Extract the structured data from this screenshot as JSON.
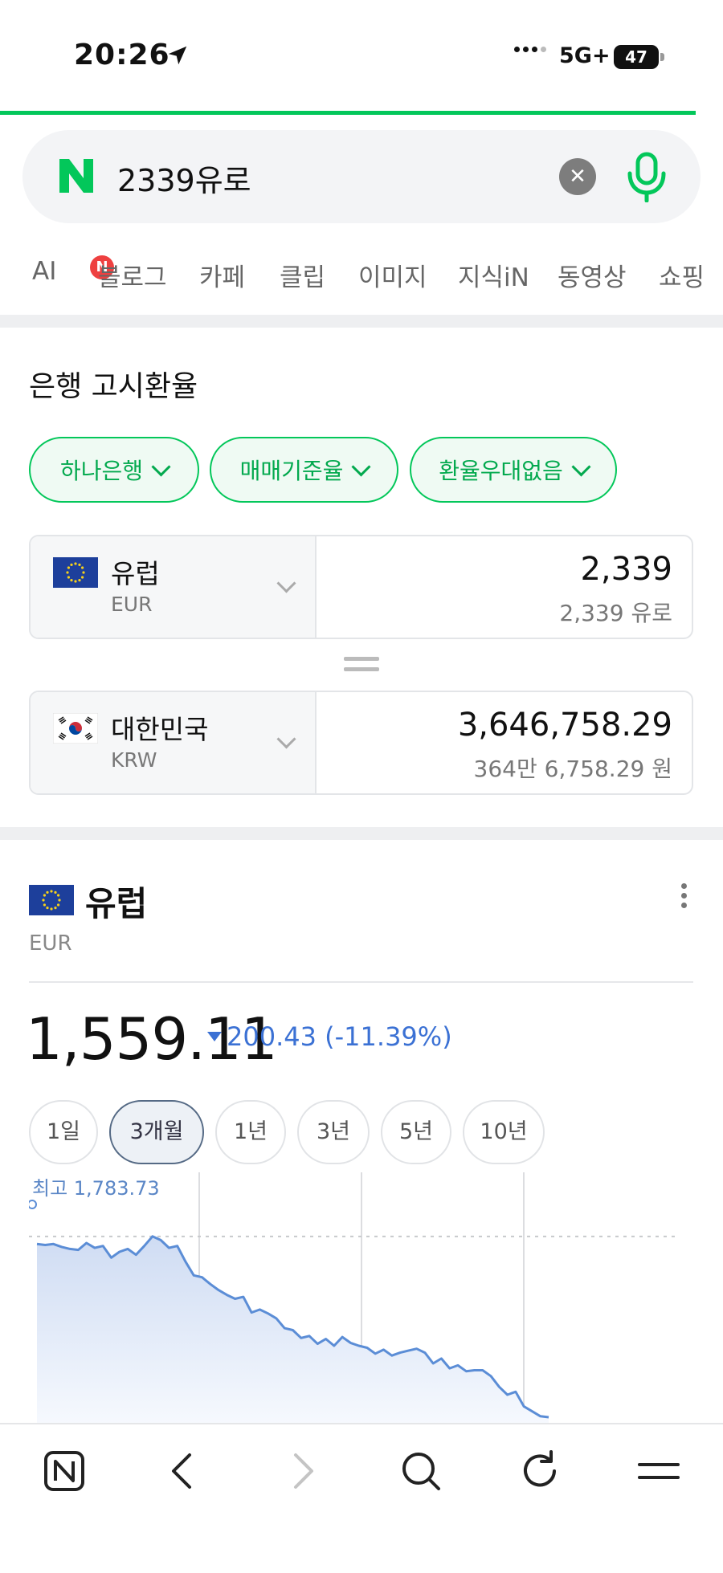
{
  "status_bar": {
    "time": "20:26",
    "network": "5G+",
    "battery": "47"
  },
  "search": {
    "query": "2339유로",
    "logo": "N"
  },
  "tabs": [
    {
      "label": "AI",
      "badge": "N"
    },
    {
      "label": "블로그"
    },
    {
      "label": "카페"
    },
    {
      "label": "클립"
    },
    {
      "label": "이미지"
    },
    {
      "label": "지식iN"
    },
    {
      "label": "동영상"
    },
    {
      "label": "쇼핑"
    }
  ],
  "exchange": {
    "title": "은행 고시환율",
    "chips": [
      "하나은행",
      "매매기준율",
      "환율우대없음"
    ],
    "from": {
      "name": "유럽",
      "code": "EUR",
      "amount": "2,339",
      "amount_read": "2,339 유로"
    },
    "to": {
      "name": "대한민국",
      "code": "KRW",
      "amount": "3,646,758.29",
      "amount_read": "364만 6,758.29 원"
    }
  },
  "rate_section": {
    "name": "유럽",
    "code": "EUR",
    "rate": "1,559.11",
    "change": "200.43 (-11.39%)",
    "change_direction": "down",
    "periods": [
      "1일",
      "3개월",
      "1년",
      "3년",
      "5년",
      "10년"
    ],
    "active_period": "3개월",
    "high_label": "최고 1,783.73"
  },
  "chart_data": {
    "type": "area",
    "title": "",
    "series": [
      {
        "values": [
          1776,
          1775,
          1776,
          1773,
          1771,
          1770,
          1777,
          1772,
          1774,
          1762,
          1768,
          1771,
          1765,
          1774,
          1783.73,
          1780,
          1772,
          1774,
          1758,
          1744,
          1742,
          1735,
          1729,
          1724,
          1720,
          1722,
          1706,
          1709,
          1705,
          1700,
          1690,
          1688,
          1680,
          1682,
          1674,
          1679,
          1672,
          1681,
          1675,
          1672,
          1670,
          1664,
          1668,
          1662,
          1665,
          1667,
          1669,
          1665,
          1654,
          1659,
          1649,
          1652,
          1646,
          1647,
          1647,
          1641,
          1630,
          1622,
          1625,
          1610,
          1605,
          1600,
          1599
        ]
      }
    ],
    "high": 1783.73,
    "ylim": [
      1590,
      1800
    ],
    "grid": true
  },
  "colors": {
    "naver_green": "#03c75a",
    "down_blue": "#3b71d4",
    "chart_line": "#5b8dd6"
  },
  "bottom_bar": [
    "naver-home-icon",
    "back-icon",
    "forward-icon",
    "search-icon",
    "reload-icon",
    "menu-icon"
  ]
}
